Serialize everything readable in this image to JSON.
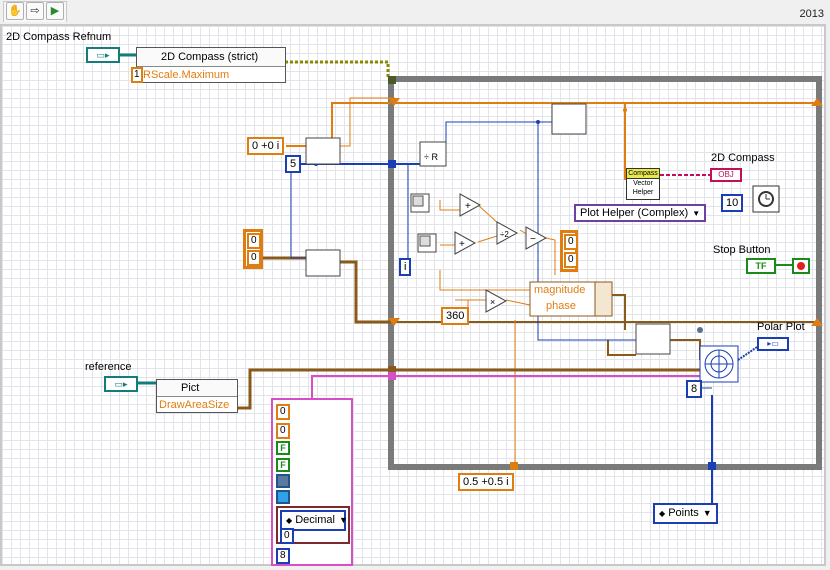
{
  "window": {
    "version": "2013"
  },
  "toolbar": {
    "items": [
      {
        "name": "hand-icon",
        "glyph": "✋"
      },
      {
        "name": "arrow-icon",
        "glyph": "⇨"
      },
      {
        "name": "run-icon",
        "glyph": "▶"
      }
    ]
  },
  "diagram": {
    "refnum_label": "2D Compass Refnum",
    "property_node": {
      "class": "2D Compass (strict)",
      "property": "RScale.Maximum",
      "input": "1"
    },
    "consts": {
      "complex_zero": "0 +0 i",
      "loop_count": "5",
      "cluster_a": "0",
      "cluster_b": "0",
      "iteration": "i",
      "angle_max": "360",
      "complex_half": "0.5 +0.5 i",
      "wait_ms": "10",
      "points_index": "8",
      "mag_a": "0",
      "mag_b": "0"
    },
    "unbundle": {
      "field1": "magnitude",
      "field2": "phase"
    },
    "compass_label": "2D Compass",
    "compass_node": {
      "line1": "Compass",
      "line2": "Vector",
      "line3": "Helper"
    },
    "obj_tag": "OBJ",
    "plot_helper": "Plot Helper (Complex)",
    "stop_label": "Stop Button",
    "stop_terminal": "TF",
    "polar_plot_label": "Polar Plot",
    "reference_label": "reference",
    "pict_node": {
      "class": "Pict",
      "property": "DrawAreaSize"
    },
    "cluster_panel": {
      "n1": "0",
      "n2": "0",
      "b1": "F",
      "b2": "F",
      "format": "Decimal",
      "value": "0",
      "count": "8"
    },
    "points_enum": "Points"
  }
}
